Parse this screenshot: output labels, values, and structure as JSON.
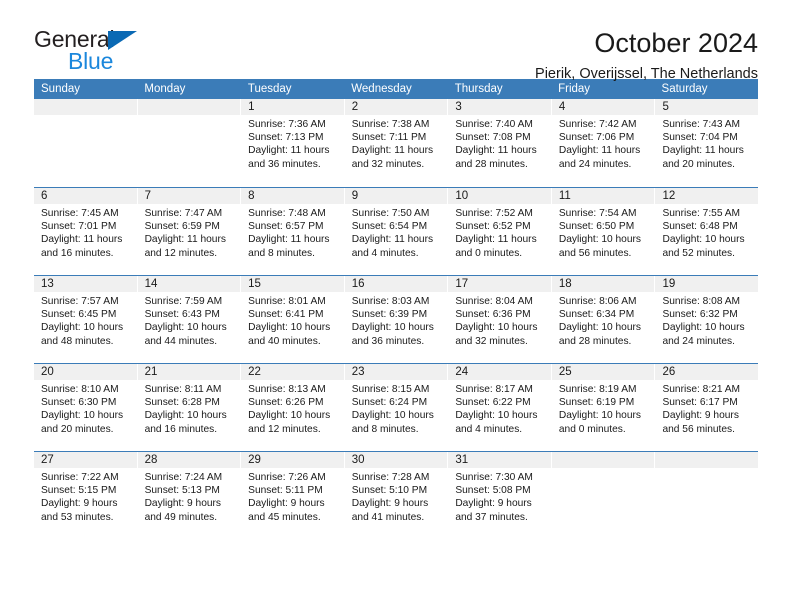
{
  "logo": {
    "word_general": "General",
    "word_blue": "Blue",
    "accent_color": "#1b87dc",
    "triangle_color": "#0a69b4"
  },
  "header": {
    "title": "October 2024",
    "subtitle": "Pierik, Overijssel, The Netherlands"
  },
  "calendar": {
    "header_bg": "#3b7cb8",
    "daynum_bg": "#f0f0f0",
    "weekdays": [
      "Sunday",
      "Monday",
      "Tuesday",
      "Wednesday",
      "Thursday",
      "Friday",
      "Saturday"
    ],
    "weeks": [
      [
        {
          "day": "",
          "empty": true
        },
        {
          "day": "",
          "empty": true
        },
        {
          "day": "1",
          "sunrise": "Sunrise: 7:36 AM",
          "sunset": "Sunset: 7:13 PM",
          "daylight": "Daylight: 11 hours and 36 minutes."
        },
        {
          "day": "2",
          "sunrise": "Sunrise: 7:38 AM",
          "sunset": "Sunset: 7:11 PM",
          "daylight": "Daylight: 11 hours and 32 minutes."
        },
        {
          "day": "3",
          "sunrise": "Sunrise: 7:40 AM",
          "sunset": "Sunset: 7:08 PM",
          "daylight": "Daylight: 11 hours and 28 minutes."
        },
        {
          "day": "4",
          "sunrise": "Sunrise: 7:42 AM",
          "sunset": "Sunset: 7:06 PM",
          "daylight": "Daylight: 11 hours and 24 minutes."
        },
        {
          "day": "5",
          "sunrise": "Sunrise: 7:43 AM",
          "sunset": "Sunset: 7:04 PM",
          "daylight": "Daylight: 11 hours and 20 minutes."
        }
      ],
      [
        {
          "day": "6",
          "sunrise": "Sunrise: 7:45 AM",
          "sunset": "Sunset: 7:01 PM",
          "daylight": "Daylight: 11 hours and 16 minutes."
        },
        {
          "day": "7",
          "sunrise": "Sunrise: 7:47 AM",
          "sunset": "Sunset: 6:59 PM",
          "daylight": "Daylight: 11 hours and 12 minutes."
        },
        {
          "day": "8",
          "sunrise": "Sunrise: 7:48 AM",
          "sunset": "Sunset: 6:57 PM",
          "daylight": "Daylight: 11 hours and 8 minutes."
        },
        {
          "day": "9",
          "sunrise": "Sunrise: 7:50 AM",
          "sunset": "Sunset: 6:54 PM",
          "daylight": "Daylight: 11 hours and 4 minutes."
        },
        {
          "day": "10",
          "sunrise": "Sunrise: 7:52 AM",
          "sunset": "Sunset: 6:52 PM",
          "daylight": "Daylight: 11 hours and 0 minutes."
        },
        {
          "day": "11",
          "sunrise": "Sunrise: 7:54 AM",
          "sunset": "Sunset: 6:50 PM",
          "daylight": "Daylight: 10 hours and 56 minutes."
        },
        {
          "day": "12",
          "sunrise": "Sunrise: 7:55 AM",
          "sunset": "Sunset: 6:48 PM",
          "daylight": "Daylight: 10 hours and 52 minutes."
        }
      ],
      [
        {
          "day": "13",
          "sunrise": "Sunrise: 7:57 AM",
          "sunset": "Sunset: 6:45 PM",
          "daylight": "Daylight: 10 hours and 48 minutes."
        },
        {
          "day": "14",
          "sunrise": "Sunrise: 7:59 AM",
          "sunset": "Sunset: 6:43 PM",
          "daylight": "Daylight: 10 hours and 44 minutes."
        },
        {
          "day": "15",
          "sunrise": "Sunrise: 8:01 AM",
          "sunset": "Sunset: 6:41 PM",
          "daylight": "Daylight: 10 hours and 40 minutes."
        },
        {
          "day": "16",
          "sunrise": "Sunrise: 8:03 AM",
          "sunset": "Sunset: 6:39 PM",
          "daylight": "Daylight: 10 hours and 36 minutes."
        },
        {
          "day": "17",
          "sunrise": "Sunrise: 8:04 AM",
          "sunset": "Sunset: 6:36 PM",
          "daylight": "Daylight: 10 hours and 32 minutes."
        },
        {
          "day": "18",
          "sunrise": "Sunrise: 8:06 AM",
          "sunset": "Sunset: 6:34 PM",
          "daylight": "Daylight: 10 hours and 28 minutes."
        },
        {
          "day": "19",
          "sunrise": "Sunrise: 8:08 AM",
          "sunset": "Sunset: 6:32 PM",
          "daylight": "Daylight: 10 hours and 24 minutes."
        }
      ],
      [
        {
          "day": "20",
          "sunrise": "Sunrise: 8:10 AM",
          "sunset": "Sunset: 6:30 PM",
          "daylight": "Daylight: 10 hours and 20 minutes."
        },
        {
          "day": "21",
          "sunrise": "Sunrise: 8:11 AM",
          "sunset": "Sunset: 6:28 PM",
          "daylight": "Daylight: 10 hours and 16 minutes."
        },
        {
          "day": "22",
          "sunrise": "Sunrise: 8:13 AM",
          "sunset": "Sunset: 6:26 PM",
          "daylight": "Daylight: 10 hours and 12 minutes."
        },
        {
          "day": "23",
          "sunrise": "Sunrise: 8:15 AM",
          "sunset": "Sunset: 6:24 PM",
          "daylight": "Daylight: 10 hours and 8 minutes."
        },
        {
          "day": "24",
          "sunrise": "Sunrise: 8:17 AM",
          "sunset": "Sunset: 6:22 PM",
          "daylight": "Daylight: 10 hours and 4 minutes."
        },
        {
          "day": "25",
          "sunrise": "Sunrise: 8:19 AM",
          "sunset": "Sunset: 6:19 PM",
          "daylight": "Daylight: 10 hours and 0 minutes."
        },
        {
          "day": "26",
          "sunrise": "Sunrise: 8:21 AM",
          "sunset": "Sunset: 6:17 PM",
          "daylight": "Daylight: 9 hours and 56 minutes."
        }
      ],
      [
        {
          "day": "27",
          "sunrise": "Sunrise: 7:22 AM",
          "sunset": "Sunset: 5:15 PM",
          "daylight": "Daylight: 9 hours and 53 minutes."
        },
        {
          "day": "28",
          "sunrise": "Sunrise: 7:24 AM",
          "sunset": "Sunset: 5:13 PM",
          "daylight": "Daylight: 9 hours and 49 minutes."
        },
        {
          "day": "29",
          "sunrise": "Sunrise: 7:26 AM",
          "sunset": "Sunset: 5:11 PM",
          "daylight": "Daylight: 9 hours and 45 minutes."
        },
        {
          "day": "30",
          "sunrise": "Sunrise: 7:28 AM",
          "sunset": "Sunset: 5:10 PM",
          "daylight": "Daylight: 9 hours and 41 minutes."
        },
        {
          "day": "31",
          "sunrise": "Sunrise: 7:30 AM",
          "sunset": "Sunset: 5:08 PM",
          "daylight": "Daylight: 9 hours and 37 minutes."
        },
        {
          "day": "",
          "empty": true
        },
        {
          "day": "",
          "empty": true
        }
      ]
    ]
  }
}
